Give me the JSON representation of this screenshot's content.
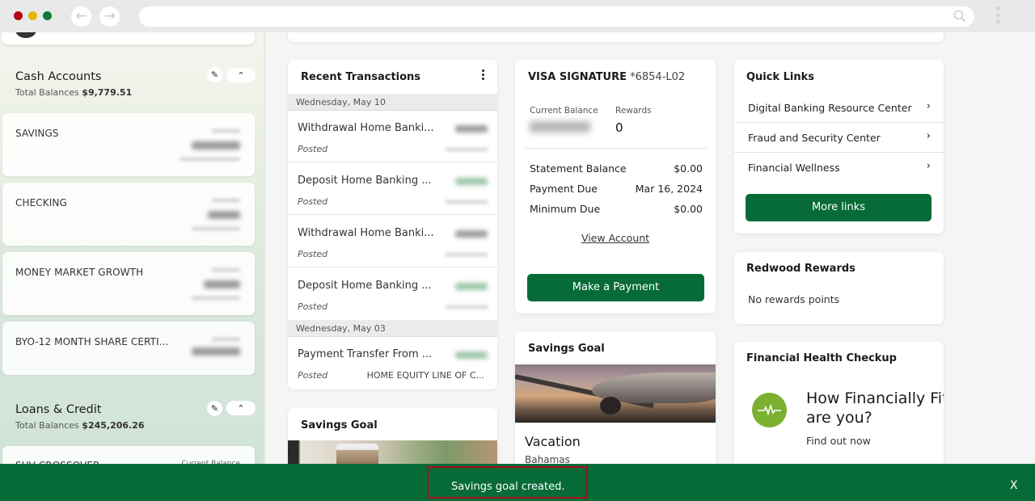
{
  "browser": {
    "back_icon": "arrow-left-icon",
    "forward_icon": "arrow-right-icon",
    "url": "",
    "search_icon": "search-icon",
    "menu_icon": "kebab-menu-icon"
  },
  "sidebar": {
    "cash_accounts": {
      "title": "Cash Accounts",
      "total_label": "Total Balances",
      "total_value": "$9,779.51",
      "accounts": [
        {
          "name": "SAVINGS"
        },
        {
          "name": "CHECKING"
        },
        {
          "name": "MONEY MARKET GROWTH"
        },
        {
          "name": "BYO-12 MONTH SHARE CERTI..."
        }
      ]
    },
    "loans_credit": {
      "title": "Loans & Credit",
      "total_label": "Total Balances",
      "total_value": "$245,206.26",
      "accounts": [
        {
          "name": "SUV CROSSOVER",
          "balance_label": "Current Balance"
        }
      ]
    }
  },
  "transactions": {
    "title": "Recent Transactions",
    "groups": [
      {
        "date": "Wednesday, May 10",
        "items": [
          {
            "description": "Withdrawal Home Banki...",
            "status": "Posted",
            "type": "debit"
          },
          {
            "description": "Deposit Home Banking ...",
            "status": "Posted",
            "type": "credit"
          },
          {
            "description": "Withdrawal Home Banki...",
            "status": "Posted",
            "type": "debit"
          },
          {
            "description": "Deposit Home Banking ...",
            "status": "Posted",
            "type": "credit"
          }
        ]
      },
      {
        "date": "Wednesday, May 03",
        "items": [
          {
            "description": "Payment Transfer From ...",
            "status": "Posted",
            "type": "credit",
            "account": "HOME EQUITY LINE OF C..."
          }
        ]
      }
    ]
  },
  "visa": {
    "name": "VISA SIGNATURE",
    "number": "*6854-L02",
    "current_balance_label": "Current Balance",
    "rewards_label": "Rewards",
    "rewards_value": "0",
    "rows": [
      {
        "label": "Statement Balance",
        "value": "$0.00"
      },
      {
        "label": "Payment Due",
        "value": "Mar 16, 2024"
      },
      {
        "label": "Minimum Due",
        "value": "$0.00"
      }
    ],
    "view_account": "View Account",
    "make_payment": "Make a Payment"
  },
  "savings_goals": [
    {
      "title": "Savings Goal",
      "name": "Vacation",
      "description": "Bahamas"
    },
    {
      "title": "Savings Goal"
    }
  ],
  "quick_links": {
    "title": "Quick Links",
    "items": [
      {
        "label": "Digital Banking Resource Center"
      },
      {
        "label": "Fraud and Security Center"
      },
      {
        "label": "Financial Wellness"
      }
    ],
    "more": "More links"
  },
  "rewards": {
    "title": "Redwood Rewards",
    "text": "No rewards points"
  },
  "health": {
    "title": "Financial Health Checkup",
    "headline_1": "How Financially Fit",
    "headline_2": "are you?",
    "link": "Find out now",
    "icon_color": "#7bb030"
  },
  "toast": {
    "message": "Savings goal created.",
    "close": "X",
    "background": "#076b38"
  }
}
